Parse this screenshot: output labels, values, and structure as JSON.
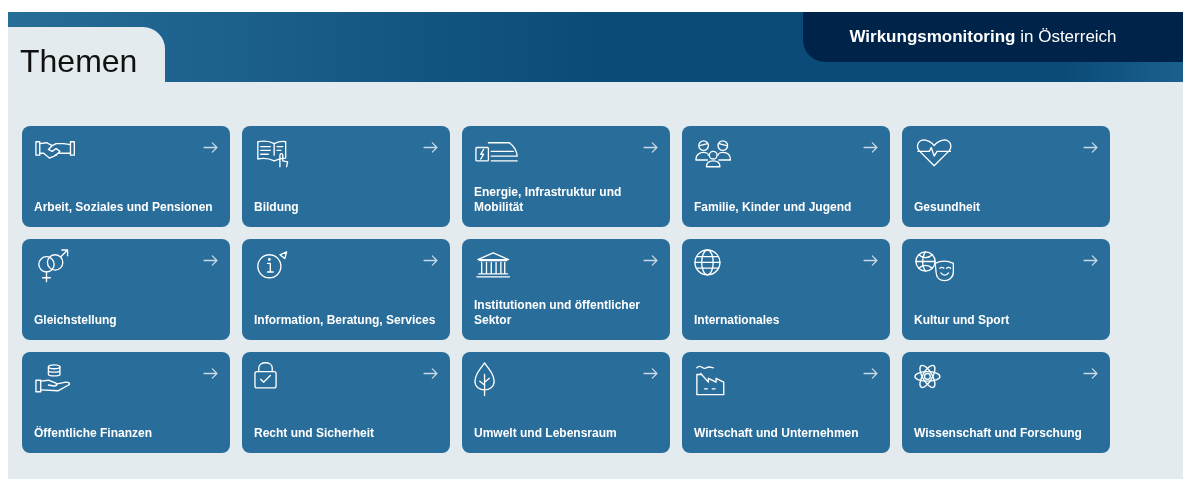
{
  "header": {
    "title": "Themen",
    "site_title": "**Wirkungsmonitoring** in Österreich"
  },
  "topics": [
    {
      "label": "Arbeit, Soziales und Pensionen"
    },
    {
      "label": "Bildung"
    },
    {
      "label": "Energie, Infrastruktur und Mobilität"
    },
    {
      "label": "Familie, Kinder und Jugend"
    },
    {
      "label": "Gesundheit"
    },
    {
      "label": "Gleichstellung"
    },
    {
      "label": "Information, Beratung, Services"
    },
    {
      "label": "Institutionen und öffentlicher Sektor"
    },
    {
      "label": "Internationales"
    },
    {
      "label": "Kultur und Sport"
    },
    {
      "label": "Öffentliche Finanzen"
    },
    {
      "label": "Recht und Sicherheit"
    },
    {
      "label": "Umwelt und Lebensraum"
    },
    {
      "label": "Wirtschaft und Unternehmen"
    },
    {
      "label": "Wissenschaft und Forschung"
    }
  ]
}
